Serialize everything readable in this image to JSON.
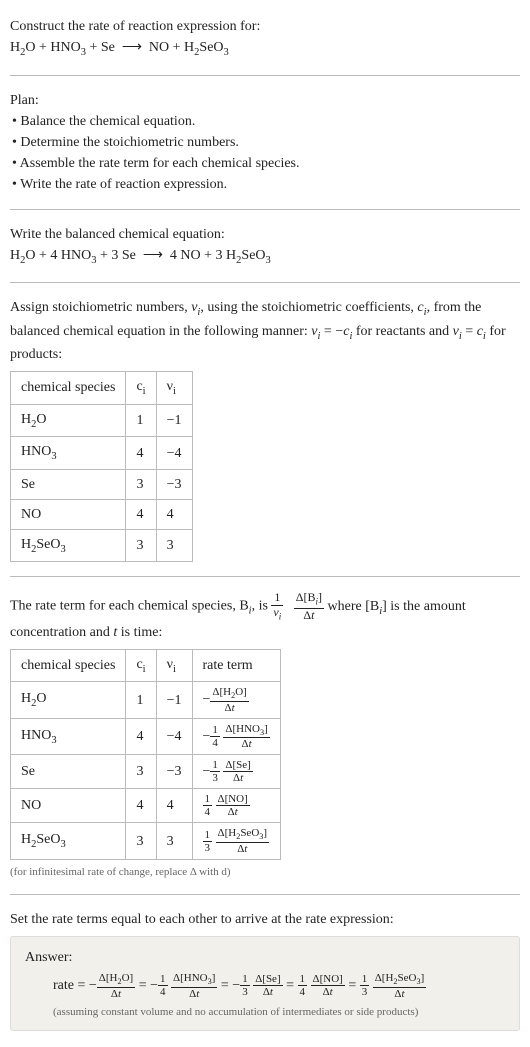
{
  "intro": {
    "line1": "Construct the rate of reaction expression for:",
    "equation_unbalanced_html": "H<sub>2</sub>O + HNO<sub>3</sub> + Se &nbsp;⟶&nbsp; NO + H<sub>2</sub>SeO<sub>3</sub>"
  },
  "plan": {
    "title": "Plan:",
    "items": [
      "• Balance the chemical equation.",
      "• Determine the stoichiometric numbers.",
      "• Assemble the rate term for each chemical species.",
      "• Write the rate of reaction expression."
    ]
  },
  "balanced": {
    "title": "Write the balanced chemical equation:",
    "equation_html": "H<sub>2</sub>O + 4 HNO<sub>3</sub> + 3 Se &nbsp;⟶&nbsp; 4 NO + 3 H<sub>2</sub>SeO<sub>3</sub>"
  },
  "assign": {
    "text_html": "Assign stoichiometric numbers, <span class='ital'>ν<sub>i</sub></span>, using the stoichiometric coefficients, <span class='ital'>c<sub>i</sub></span>, from the balanced chemical equation in the following manner: <span class='ital'>ν<sub>i</sub></span> = −<span class='ital'>c<sub>i</sub></span> for reactants and <span class='ital'>ν<sub>i</sub></span> = <span class='ital'>c<sub>i</sub></span> for products:",
    "headers": {
      "species": "chemical species",
      "ci": "c<sub>i</sub>",
      "vi": "ν<sub>i</sub>"
    },
    "rows": [
      {
        "species_html": "H<sub>2</sub>O",
        "ci": "1",
        "vi": "−1"
      },
      {
        "species_html": "HNO<sub>3</sub>",
        "ci": "4",
        "vi": "−4"
      },
      {
        "species_html": "Se",
        "ci": "3",
        "vi": "−3"
      },
      {
        "species_html": "NO",
        "ci": "4",
        "vi": "4"
      },
      {
        "species_html": "H<sub>2</sub>SeO<sub>3</sub>",
        "ci": "3",
        "vi": "3"
      }
    ]
  },
  "rateterm_intro": {
    "prefix": "The rate term for each chemical species, B",
    "sub": "i",
    "mid": ", is ",
    "frac1_num": "1",
    "frac1_den_html": "<span class='ital'>ν<sub>i</sub></span>",
    "frac2_num_html": "Δ[B<sub><span class='ital'>i</span></sub>]",
    "frac2_den_html": "Δ<span class='ital'>t</span>",
    "suffix_html": " where [B<sub><span class='ital'>i</span></sub>] is the amount concentration and <span class='ital'>t</span> is time:"
  },
  "rate_table": {
    "headers": {
      "species": "chemical species",
      "ci": "c<sub>i</sub>",
      "vi": "ν<sub>i</sub>",
      "rate": "rate term"
    },
    "rows": [
      {
        "species_html": "H<sub>2</sub>O",
        "ci": "1",
        "vi": "−1",
        "prefix": "−",
        "coef_num": "",
        "coef_den": "",
        "num_html": "Δ[H<sub>2</sub>O]",
        "den_html": "Δ<span class='ital'>t</span>"
      },
      {
        "species_html": "HNO<sub>3</sub>",
        "ci": "4",
        "vi": "−4",
        "prefix": "−",
        "coef_num": "1",
        "coef_den": "4",
        "num_html": "Δ[HNO<sub>3</sub>]",
        "den_html": "Δ<span class='ital'>t</span>"
      },
      {
        "species_html": "Se",
        "ci": "3",
        "vi": "−3",
        "prefix": "−",
        "coef_num": "1",
        "coef_den": "3",
        "num_html": "Δ[Se]",
        "den_html": "Δ<span class='ital'>t</span>"
      },
      {
        "species_html": "NO",
        "ci": "4",
        "vi": "4",
        "prefix": "",
        "coef_num": "1",
        "coef_den": "4",
        "num_html": "Δ[NO]",
        "den_html": "Δ<span class='ital'>t</span>"
      },
      {
        "species_html": "H<sub>2</sub>SeO<sub>3</sub>",
        "ci": "3",
        "vi": "3",
        "prefix": "",
        "coef_num": "1",
        "coef_den": "3",
        "num_html": "Δ[H<sub>2</sub>SeO<sub>3</sub>]",
        "den_html": "Δ<span class='ital'>t</span>"
      }
    ],
    "note": "(for infinitesimal rate of change, replace Δ with d)"
  },
  "set_equal": "Set the rate terms equal to each other to arrive at the rate expression:",
  "answer": {
    "title": "Answer:",
    "rate_label": "rate = ",
    "terms": [
      {
        "prefix": "−",
        "coef_num": "",
        "coef_den": "",
        "num_html": "Δ[H<sub>2</sub>O]",
        "den_html": "Δ<span class='ital'>t</span>"
      },
      {
        "prefix": "−",
        "coef_num": "1",
        "coef_den": "4",
        "num_html": "Δ[HNO<sub>3</sub>]",
        "den_html": "Δ<span class='ital'>t</span>"
      },
      {
        "prefix": "−",
        "coef_num": "1",
        "coef_den": "3",
        "num_html": "Δ[Se]",
        "den_html": "Δ<span class='ital'>t</span>"
      },
      {
        "prefix": "",
        "coef_num": "1",
        "coef_den": "4",
        "num_html": "Δ[NO]",
        "den_html": "Δ<span class='ital'>t</span>"
      },
      {
        "prefix": "",
        "coef_num": "1",
        "coef_den": "3",
        "num_html": "Δ[H<sub>2</sub>SeO<sub>3</sub>]",
        "den_html": "Δ<span class='ital'>t</span>"
      }
    ],
    "assumption": "(assuming constant volume and no accumulation of intermediates or side products)"
  }
}
